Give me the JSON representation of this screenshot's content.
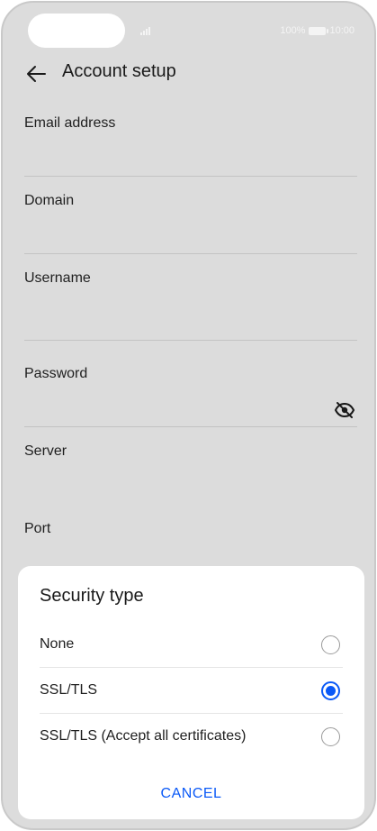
{
  "status_bar": {
    "battery_percent": "100%",
    "time": "10:00"
  },
  "header": {
    "title": "Account setup"
  },
  "form": {
    "email_label": "Email address",
    "email_value": "",
    "domain_label": "Domain",
    "domain_value": "",
    "username_label": "Username",
    "username_value": "",
    "password_label": "Password",
    "password_value": "",
    "server_label": "Server",
    "server_value": "",
    "port_label": "Port",
    "port_value": ""
  },
  "security_dialog": {
    "title": "Security type",
    "options": [
      {
        "label": "None",
        "selected": false
      },
      {
        "label": "SSL/TLS",
        "selected": true
      },
      {
        "label": "SSL/TLS (Accept all certificates)",
        "selected": false
      }
    ],
    "cancel_label": "CANCEL"
  },
  "icons": {
    "back": "arrow-left-icon",
    "password_visibility": "eye-off-icon",
    "signal": "signal-icon",
    "battery": "battery-icon"
  },
  "colors": {
    "accent": "#0a59f7",
    "screen_dim": "#dcdcdc",
    "sheet_bg": "#ffffff"
  }
}
